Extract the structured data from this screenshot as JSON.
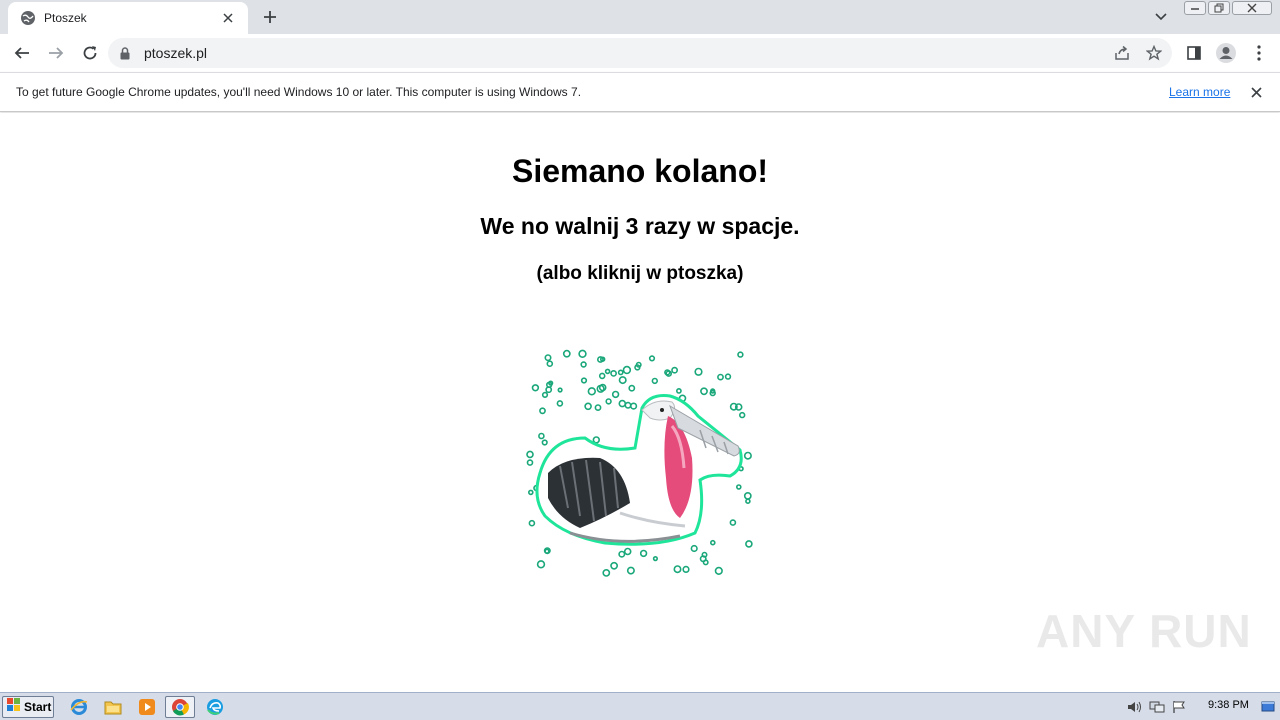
{
  "browser": {
    "tab": {
      "title": "Ptoszek",
      "favicon": "globe-icon"
    },
    "address_bar": {
      "url": "ptoszek.pl"
    },
    "icons": [
      "back-arrow-icon",
      "forward-arrow-icon",
      "reload-icon",
      "lock-icon",
      "share-icon",
      "star-icon",
      "side-panel-icon",
      "profile-icon",
      "menu-dots-icon"
    ]
  },
  "infobar": {
    "message": "To get future Google Chrome updates, you'll need Windows 10 or later. This computer is using Windows 7.",
    "link": "Learn more"
  },
  "page": {
    "heading": "Siemano kolano!",
    "subheading": "We no walnij 3 razy w spacje.",
    "hint": "(albo kliknij w ptoszka)",
    "image": "pelican-image"
  },
  "watermark": "ANY RUN",
  "taskbar": {
    "start_label": "Start",
    "apps": [
      "ie-icon",
      "explorer-folder-icon",
      "media-player-icon",
      "chrome-icon",
      "edge-icon"
    ],
    "clock": "9:38 PM"
  },
  "colors": {
    "tabstrip": "#dee1e6",
    "omnibox": "#f1f3f4",
    "link": "#1a73e8",
    "taskbar": "#d6dde9",
    "bird_outline": "#1ee59a"
  }
}
